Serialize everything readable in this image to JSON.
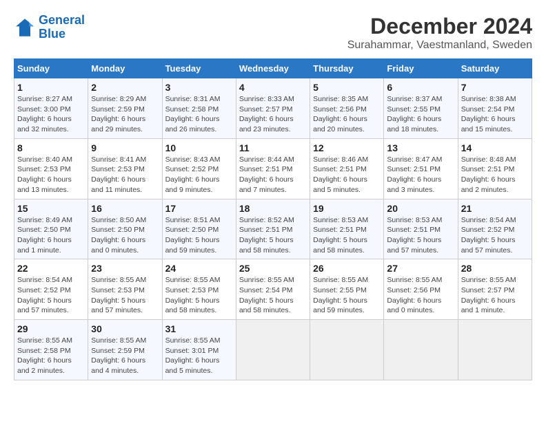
{
  "logo": {
    "line1": "General",
    "line2": "Blue"
  },
  "title": "December 2024",
  "subtitle": "Surahammar, Vaestmanland, Sweden",
  "days_of_week": [
    "Sunday",
    "Monday",
    "Tuesday",
    "Wednesday",
    "Thursday",
    "Friday",
    "Saturday"
  ],
  "weeks": [
    [
      {
        "day": "1",
        "info": "Sunrise: 8:27 AM\nSunset: 3:00 PM\nDaylight: 6 hours\nand 32 minutes."
      },
      {
        "day": "2",
        "info": "Sunrise: 8:29 AM\nSunset: 2:59 PM\nDaylight: 6 hours\nand 29 minutes."
      },
      {
        "day": "3",
        "info": "Sunrise: 8:31 AM\nSunset: 2:58 PM\nDaylight: 6 hours\nand 26 minutes."
      },
      {
        "day": "4",
        "info": "Sunrise: 8:33 AM\nSunset: 2:57 PM\nDaylight: 6 hours\nand 23 minutes."
      },
      {
        "day": "5",
        "info": "Sunrise: 8:35 AM\nSunset: 2:56 PM\nDaylight: 6 hours\nand 20 minutes."
      },
      {
        "day": "6",
        "info": "Sunrise: 8:37 AM\nSunset: 2:55 PM\nDaylight: 6 hours\nand 18 minutes."
      },
      {
        "day": "7",
        "info": "Sunrise: 8:38 AM\nSunset: 2:54 PM\nDaylight: 6 hours\nand 15 minutes."
      }
    ],
    [
      {
        "day": "8",
        "info": "Sunrise: 8:40 AM\nSunset: 2:53 PM\nDaylight: 6 hours\nand 13 minutes."
      },
      {
        "day": "9",
        "info": "Sunrise: 8:41 AM\nSunset: 2:53 PM\nDaylight: 6 hours\nand 11 minutes."
      },
      {
        "day": "10",
        "info": "Sunrise: 8:43 AM\nSunset: 2:52 PM\nDaylight: 6 hours\nand 9 minutes."
      },
      {
        "day": "11",
        "info": "Sunrise: 8:44 AM\nSunset: 2:51 PM\nDaylight: 6 hours\nand 7 minutes."
      },
      {
        "day": "12",
        "info": "Sunrise: 8:46 AM\nSunset: 2:51 PM\nDaylight: 6 hours\nand 5 minutes."
      },
      {
        "day": "13",
        "info": "Sunrise: 8:47 AM\nSunset: 2:51 PM\nDaylight: 6 hours\nand 3 minutes."
      },
      {
        "day": "14",
        "info": "Sunrise: 8:48 AM\nSunset: 2:51 PM\nDaylight: 6 hours\nand 2 minutes."
      }
    ],
    [
      {
        "day": "15",
        "info": "Sunrise: 8:49 AM\nSunset: 2:50 PM\nDaylight: 6 hours\nand 1 minute."
      },
      {
        "day": "16",
        "info": "Sunrise: 8:50 AM\nSunset: 2:50 PM\nDaylight: 6 hours\nand 0 minutes."
      },
      {
        "day": "17",
        "info": "Sunrise: 8:51 AM\nSunset: 2:50 PM\nDaylight: 5 hours\nand 59 minutes."
      },
      {
        "day": "18",
        "info": "Sunrise: 8:52 AM\nSunset: 2:51 PM\nDaylight: 5 hours\nand 58 minutes."
      },
      {
        "day": "19",
        "info": "Sunrise: 8:53 AM\nSunset: 2:51 PM\nDaylight: 5 hours\nand 58 minutes."
      },
      {
        "day": "20",
        "info": "Sunrise: 8:53 AM\nSunset: 2:51 PM\nDaylight: 5 hours\nand 57 minutes."
      },
      {
        "day": "21",
        "info": "Sunrise: 8:54 AM\nSunset: 2:52 PM\nDaylight: 5 hours\nand 57 minutes."
      }
    ],
    [
      {
        "day": "22",
        "info": "Sunrise: 8:54 AM\nSunset: 2:52 PM\nDaylight: 5 hours\nand 57 minutes."
      },
      {
        "day": "23",
        "info": "Sunrise: 8:55 AM\nSunset: 2:53 PM\nDaylight: 5 hours\nand 57 minutes."
      },
      {
        "day": "24",
        "info": "Sunrise: 8:55 AM\nSunset: 2:53 PM\nDaylight: 5 hours\nand 58 minutes."
      },
      {
        "day": "25",
        "info": "Sunrise: 8:55 AM\nSunset: 2:54 PM\nDaylight: 5 hours\nand 58 minutes."
      },
      {
        "day": "26",
        "info": "Sunrise: 8:55 AM\nSunset: 2:55 PM\nDaylight: 5 hours\nand 59 minutes."
      },
      {
        "day": "27",
        "info": "Sunrise: 8:55 AM\nSunset: 2:56 PM\nDaylight: 6 hours\nand 0 minutes."
      },
      {
        "day": "28",
        "info": "Sunrise: 8:55 AM\nSunset: 2:57 PM\nDaylight: 6 hours\nand 1 minute."
      }
    ],
    [
      {
        "day": "29",
        "info": "Sunrise: 8:55 AM\nSunset: 2:58 PM\nDaylight: 6 hours\nand 2 minutes."
      },
      {
        "day": "30",
        "info": "Sunrise: 8:55 AM\nSunset: 2:59 PM\nDaylight: 6 hours\nand 4 minutes."
      },
      {
        "day": "31",
        "info": "Sunrise: 8:55 AM\nSunset: 3:01 PM\nDaylight: 6 hours\nand 5 minutes."
      },
      {
        "day": "",
        "info": ""
      },
      {
        "day": "",
        "info": ""
      },
      {
        "day": "",
        "info": ""
      },
      {
        "day": "",
        "info": ""
      }
    ]
  ]
}
